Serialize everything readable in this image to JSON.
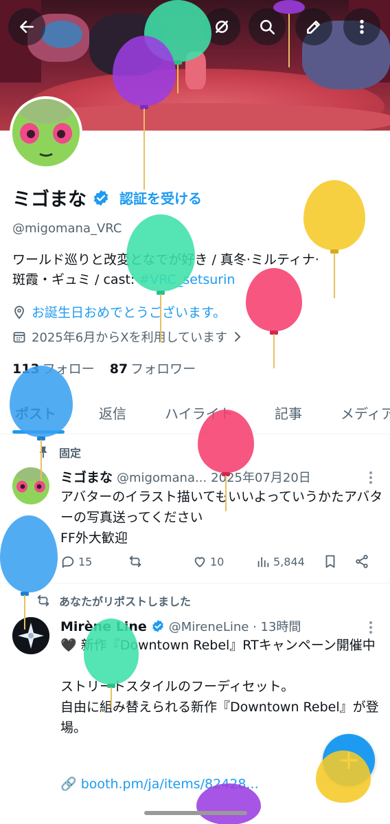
{
  "header": {
    "back_icon": "arrow-left-icon",
    "actions": [
      "trend-off-icon",
      "search-icon",
      "edit-icon",
      "more-vertical-icon"
    ]
  },
  "profile": {
    "display_name": "ミゴまな",
    "verify_link": "認証を受ける",
    "handle": "@migomana_VRC",
    "bio_line1": "ワールド巡りと改変となでが好き / 真冬·ミルティナ·",
    "bio_line2_prefix": "斑霞・ギュミ / cast: ",
    "bio_hashtag": "#VRC_setsurin",
    "birthday_text": "お誕生日おめでとうございます。",
    "joined_text": "2025年6月からXを利用しています",
    "following_count": "113",
    "following_label": "フォロー",
    "followers_count": "87",
    "followers_label": "フォロワー"
  },
  "tabs": [
    "ポスト",
    "返信",
    "ハイライト",
    "記事",
    "メディア"
  ],
  "active_tab": "ポスト",
  "pinned_post": {
    "pin_label": "固定",
    "name": "ミゴまな",
    "handle": "@migomana...",
    "date": "2025年07月20日",
    "text": "アバターのイラスト描いてもいいよっていうかたアバターの写真送ってください\nFF外大歓迎",
    "replies": "15",
    "reposts": "",
    "likes": "10",
    "views": "5,844"
  },
  "repost": {
    "repost_label": "あなたがリポストしました",
    "name": "Mirène Line",
    "handle": "@MireneLine · 13時間",
    "text": "🖤 新作『Downtown Rebel』RTキャンペーン開催中\n\nストリートスタイルのフーディセット。\n自由に組み替えられる新作『Downtown Rebel』が登場。",
    "link": "🔗 booth.pm/ja/items/82428..."
  },
  "fab": {
    "label": "+",
    "icon": "plus-icon"
  },
  "colors": {
    "accent": "#1d9bf0",
    "text_primary": "#0f1419",
    "text_secondary": "#536471"
  }
}
